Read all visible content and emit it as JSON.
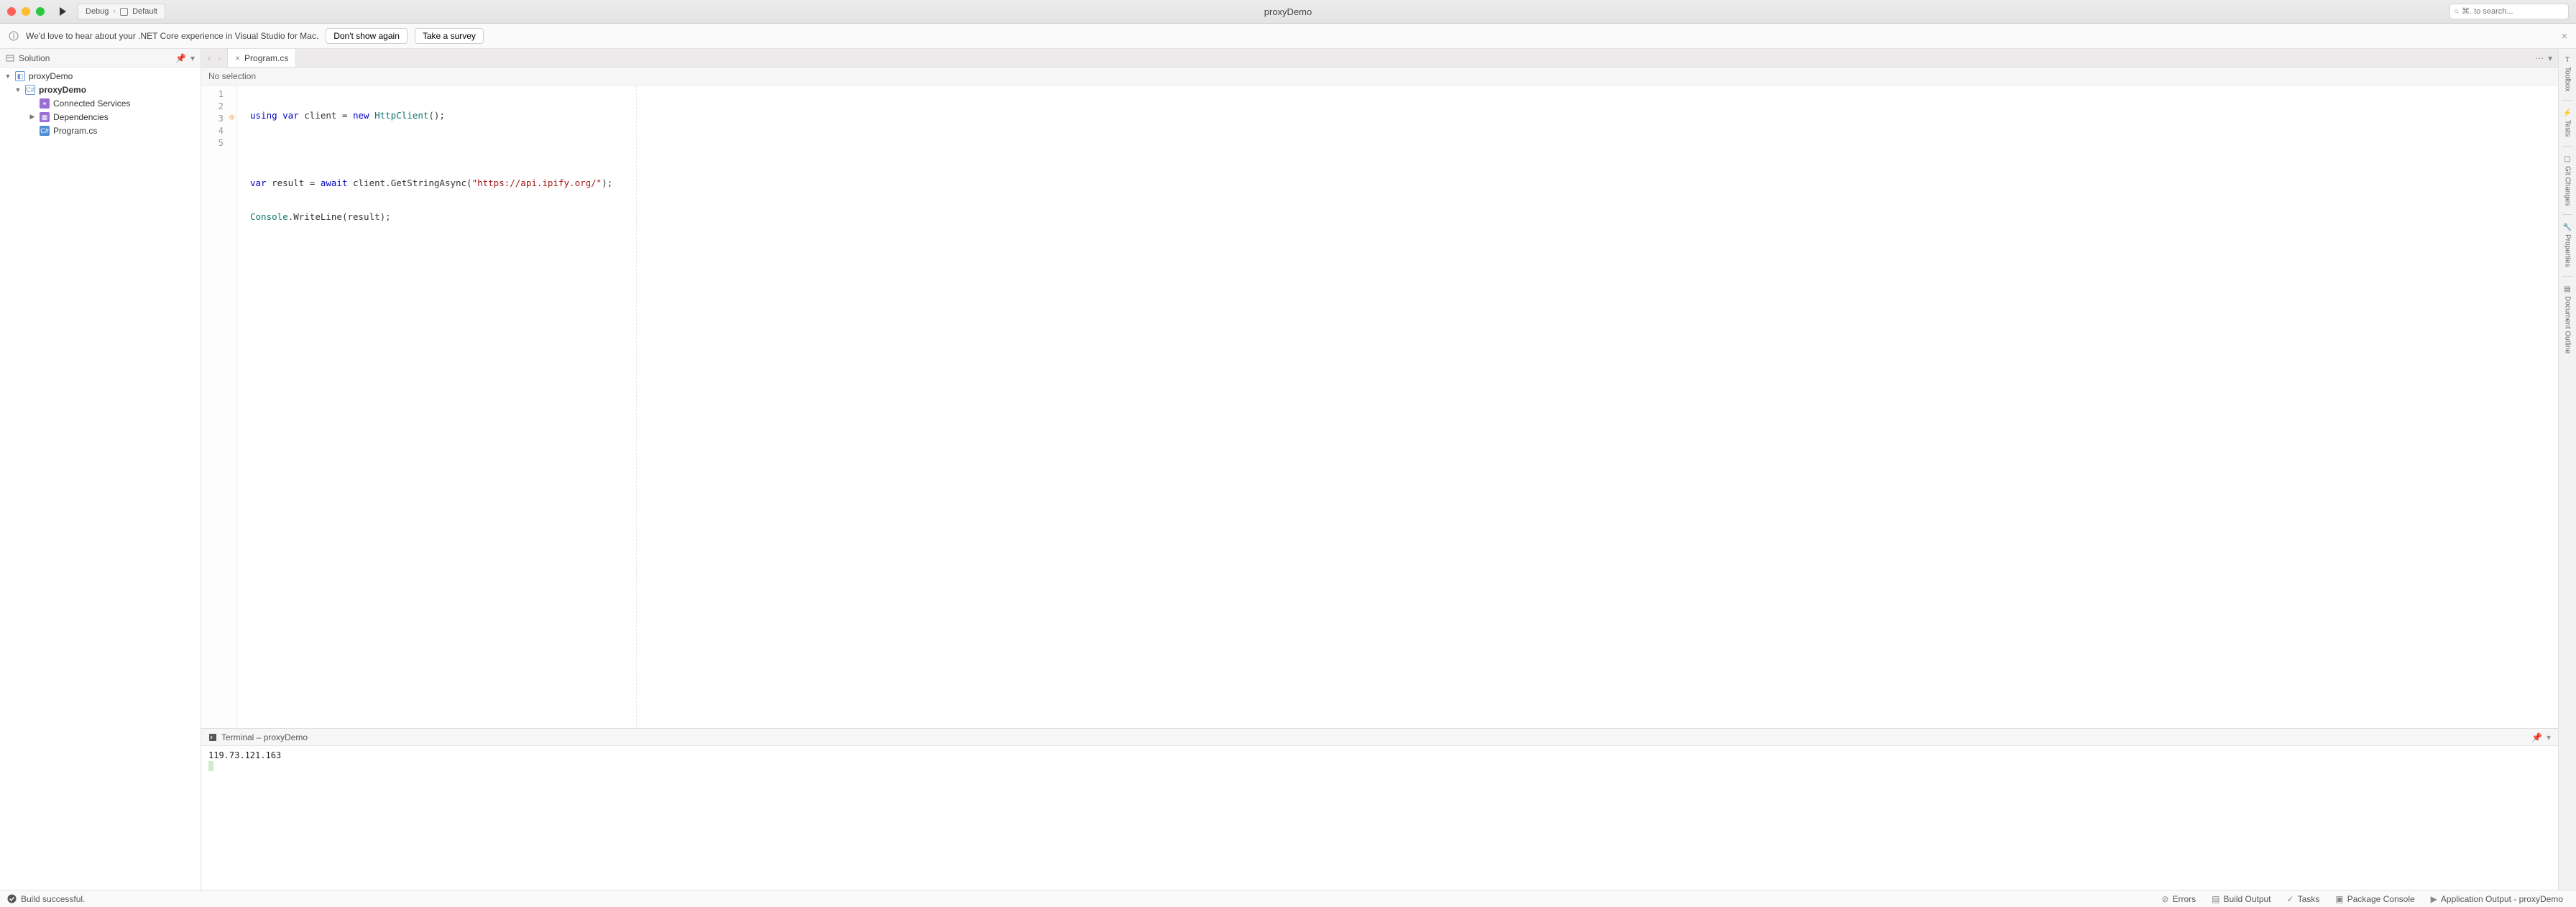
{
  "window": {
    "title": "proxyDemo"
  },
  "toolbar": {
    "config": "Debug",
    "target": "Default",
    "search_placeholder": "⌘. to search..."
  },
  "infobar": {
    "message": "We'd love to hear about your .NET Core experience in Visual Studio for Mac.",
    "dont_show": "Don't show again",
    "take_survey": "Take a survey"
  },
  "solution": {
    "title": "Solution",
    "tree": {
      "root": "proxyDemo",
      "project": "proxyDemo",
      "items": {
        "connected_services": "Connected Services",
        "dependencies": "Dependencies",
        "program_cs": "Program.cs"
      }
    }
  },
  "editor": {
    "tab": "Program.cs",
    "breadcrumb": "No selection",
    "code": {
      "lines": [
        "1",
        "2",
        "3",
        "4",
        "5"
      ],
      "l1": {
        "a": "using var",
        "b": " client = ",
        "c": "new ",
        "d": "HttpClient",
        "e": "();"
      },
      "l3": {
        "a": "var",
        "b": " result = ",
        "c": "await",
        "d": " client.GetStringAsync(",
        "e": "\"https://api.ipify.org/\"",
        "f": ");"
      },
      "l4": {
        "a": "Console",
        "b": ".WriteLine(result);"
      }
    }
  },
  "terminal": {
    "title": "Terminal – proxyDemo",
    "output": "119.73.121.163"
  },
  "right_tools": {
    "toolbox": "Toolbox",
    "tests": "Tests",
    "git": "Git Changes",
    "properties": "Properties",
    "outline": "Document Outline"
  },
  "status": {
    "build": "Build successful.",
    "errors": "Errors",
    "build_output": "Build Output",
    "tasks": "Tasks",
    "package_console": "Package Console",
    "app_output": "Application Output - proxyDemo"
  }
}
